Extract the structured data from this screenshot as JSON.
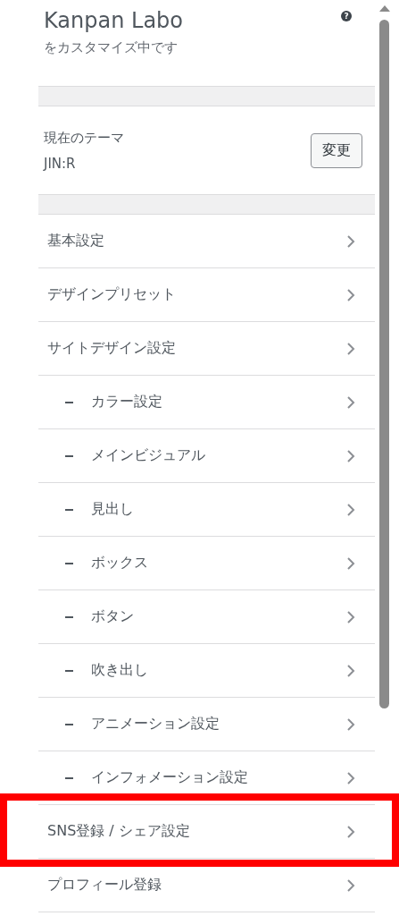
{
  "header": {
    "title": "Kanpan Labo",
    "subtitle": "をカスタマイズ中です",
    "help": "?"
  },
  "theme": {
    "label": "現在のテーマ",
    "name": "JIN:R",
    "button": "変更"
  },
  "menu": [
    {
      "label": "基本設定",
      "highlighted": false
    },
    {
      "label": "デザインプリセット",
      "highlighted": false
    },
    {
      "label": "サイトデザイン設定",
      "highlighted": false,
      "children": [
        {
          "label": "カラー設定",
          "highlighted": false
        },
        {
          "label": "メインビジュアル",
          "highlighted": false
        },
        {
          "label": "見出し",
          "highlighted": false
        },
        {
          "label": "ボックス",
          "highlighted": false
        },
        {
          "label": "ボタン",
          "highlighted": false
        },
        {
          "label": "吹き出し",
          "highlighted": false
        },
        {
          "label": "アニメーション設定",
          "highlighted": false
        },
        {
          "label": "インフォメーション設定",
          "highlighted": false
        }
      ]
    },
    {
      "label": "SNS登録 / シェア設定",
      "highlighted": true
    },
    {
      "label": "プロフィール登録",
      "highlighted": false
    }
  ]
}
